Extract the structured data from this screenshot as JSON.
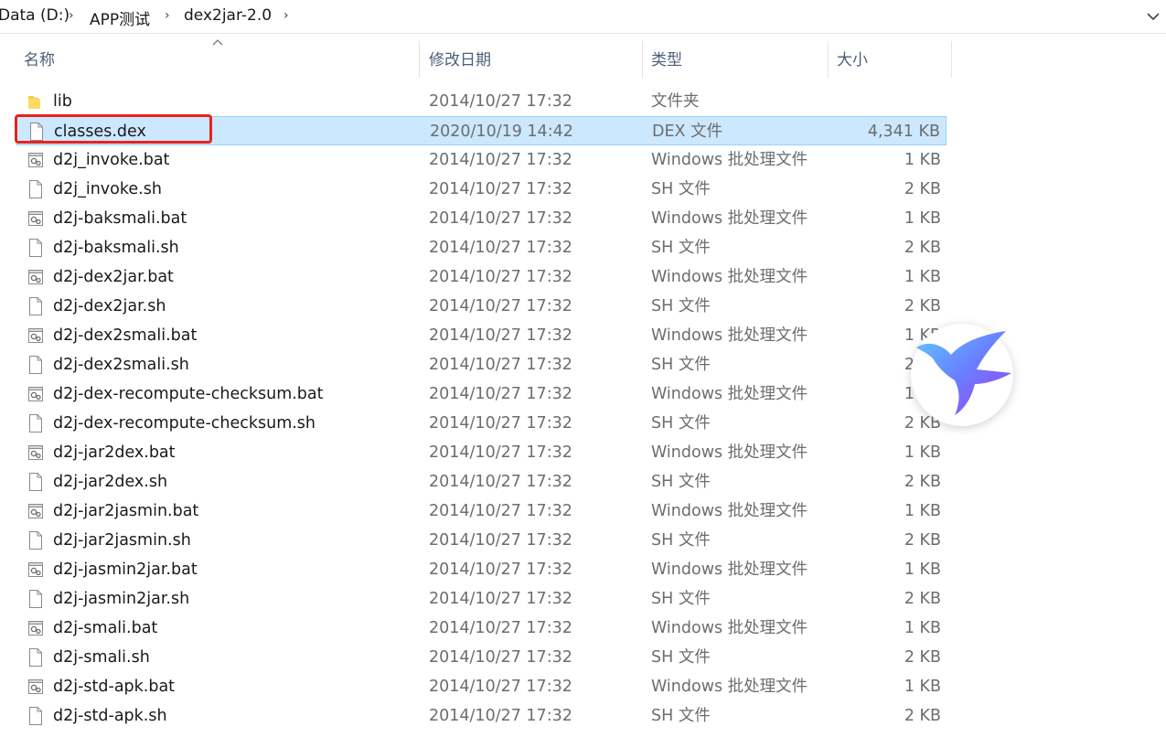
{
  "breadcrumb": {
    "items": [
      "Data (D:)",
      "APP测试",
      "dex2jar-2.0"
    ],
    "separator": "›"
  },
  "columns": {
    "name": "名称",
    "date": "修改日期",
    "type": "类型",
    "size": "大小"
  },
  "selected_index": 1,
  "highlight_index": 1,
  "colors": {
    "selection_bg": "#cce8ff",
    "selection_border": "#99d1ff",
    "highlight": "#e8221e",
    "folder": "#f8c843"
  },
  "files": [
    {
      "name": "lib",
      "date": "2014/10/27 17:32",
      "type": "文件夹",
      "size": "",
      "icon": "folder-icon"
    },
    {
      "name": "classes.dex",
      "date": "2020/10/19 14:42",
      "type": "DEX 文件",
      "size": "4,341 KB",
      "icon": "file-icon"
    },
    {
      "name": "d2j_invoke.bat",
      "date": "2014/10/27 17:32",
      "type": "Windows 批处理文件",
      "size": "1 KB",
      "icon": "batch-file-icon"
    },
    {
      "name": "d2j_invoke.sh",
      "date": "2014/10/27 17:32",
      "type": "SH 文件",
      "size": "2 KB",
      "icon": "file-icon"
    },
    {
      "name": "d2j-baksmali.bat",
      "date": "2014/10/27 17:32",
      "type": "Windows 批处理文件",
      "size": "1 KB",
      "icon": "batch-file-icon"
    },
    {
      "name": "d2j-baksmali.sh",
      "date": "2014/10/27 17:32",
      "type": "SH 文件",
      "size": "2 KB",
      "icon": "file-icon"
    },
    {
      "name": "d2j-dex2jar.bat",
      "date": "2014/10/27 17:32",
      "type": "Windows 批处理文件",
      "size": "1 KB",
      "icon": "batch-file-icon"
    },
    {
      "name": "d2j-dex2jar.sh",
      "date": "2014/10/27 17:32",
      "type": "SH 文件",
      "size": "2 KB",
      "icon": "file-icon"
    },
    {
      "name": "d2j-dex2smali.bat",
      "date": "2014/10/27 17:32",
      "type": "Windows 批处理文件",
      "size": "1 KB",
      "icon": "batch-file-icon"
    },
    {
      "name": "d2j-dex2smali.sh",
      "date": "2014/10/27 17:32",
      "type": "SH 文件",
      "size": "2 KB",
      "icon": "file-icon"
    },
    {
      "name": "d2j-dex-recompute-checksum.bat",
      "date": "2014/10/27 17:32",
      "type": "Windows 批处理文件",
      "size": "1 KB",
      "icon": "batch-file-icon"
    },
    {
      "name": "d2j-dex-recompute-checksum.sh",
      "date": "2014/10/27 17:32",
      "type": "SH 文件",
      "size": "2 KB",
      "icon": "file-icon"
    },
    {
      "name": "d2j-jar2dex.bat",
      "date": "2014/10/27 17:32",
      "type": "Windows 批处理文件",
      "size": "1 KB",
      "icon": "batch-file-icon"
    },
    {
      "name": "d2j-jar2dex.sh",
      "date": "2014/10/27 17:32",
      "type": "SH 文件",
      "size": "2 KB",
      "icon": "file-icon"
    },
    {
      "name": "d2j-jar2jasmin.bat",
      "date": "2014/10/27 17:32",
      "type": "Windows 批处理文件",
      "size": "1 KB",
      "icon": "batch-file-icon"
    },
    {
      "name": "d2j-jar2jasmin.sh",
      "date": "2014/10/27 17:32",
      "type": "SH 文件",
      "size": "2 KB",
      "icon": "file-icon"
    },
    {
      "name": "d2j-jasmin2jar.bat",
      "date": "2014/10/27 17:32",
      "type": "Windows 批处理文件",
      "size": "1 KB",
      "icon": "batch-file-icon"
    },
    {
      "name": "d2j-jasmin2jar.sh",
      "date": "2014/10/27 17:32",
      "type": "SH 文件",
      "size": "2 KB",
      "icon": "file-icon"
    },
    {
      "name": "d2j-smali.bat",
      "date": "2014/10/27 17:32",
      "type": "Windows 批处理文件",
      "size": "1 KB",
      "icon": "batch-file-icon"
    },
    {
      "name": "d2j-smali.sh",
      "date": "2014/10/27 17:32",
      "type": "SH 文件",
      "size": "2 KB",
      "icon": "file-icon"
    },
    {
      "name": "d2j-std-apk.bat",
      "date": "2014/10/27 17:32",
      "type": "Windows 批处理文件",
      "size": "1 KB",
      "icon": "batch-file-icon"
    },
    {
      "name": "d2j-std-apk.sh",
      "date": "2014/10/27 17:32",
      "type": "SH 文件",
      "size": "2 KB",
      "icon": "file-icon"
    }
  ],
  "overlay": {
    "icon": "bird-app-icon"
  }
}
